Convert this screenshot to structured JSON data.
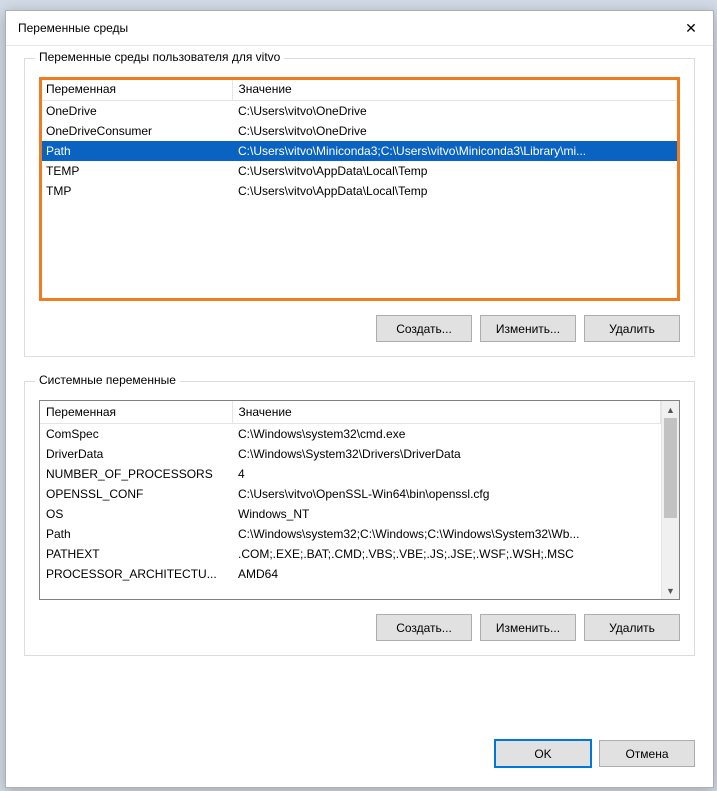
{
  "dialog": {
    "title": "Переменные среды"
  },
  "user_group": {
    "legend": "Переменные среды пользователя для vitvo",
    "col_var": "Переменная",
    "col_val": "Значение",
    "rows": [
      {
        "var": "OneDrive",
        "val": "C:\\Users\\vitvo\\OneDrive",
        "selected": false
      },
      {
        "var": "OneDriveConsumer",
        "val": "C:\\Users\\vitvo\\OneDrive",
        "selected": false
      },
      {
        "var": "Path",
        "val": "C:\\Users\\vitvo\\Miniconda3;C:\\Users\\vitvo\\Miniconda3\\Library\\mi...",
        "selected": true
      },
      {
        "var": "TEMP",
        "val": "C:\\Users\\vitvo\\AppData\\Local\\Temp",
        "selected": false
      },
      {
        "var": "TMP",
        "val": "C:\\Users\\vitvo\\AppData\\Local\\Temp",
        "selected": false
      }
    ],
    "btn_new": "Создать...",
    "btn_edit": "Изменить...",
    "btn_delete": "Удалить"
  },
  "system_group": {
    "legend": "Системные переменные",
    "col_var": "Переменная",
    "col_val": "Значение",
    "rows": [
      {
        "var": "ComSpec",
        "val": "C:\\Windows\\system32\\cmd.exe"
      },
      {
        "var": "DriverData",
        "val": "C:\\Windows\\System32\\Drivers\\DriverData"
      },
      {
        "var": "NUMBER_OF_PROCESSORS",
        "val": "4"
      },
      {
        "var": "OPENSSL_CONF",
        "val": "C:\\Users\\vitvo\\OpenSSL-Win64\\bin\\openssl.cfg"
      },
      {
        "var": "OS",
        "val": "Windows_NT"
      },
      {
        "var": "Path",
        "val": "C:\\Windows\\system32;C:\\Windows;C:\\Windows\\System32\\Wb..."
      },
      {
        "var": "PATHEXT",
        "val": ".COM;.EXE;.BAT;.CMD;.VBS;.VBE;.JS;.JSE;.WSF;.WSH;.MSC"
      },
      {
        "var": "PROCESSOR_ARCHITECTU...",
        "val": "AMD64"
      }
    ],
    "btn_new": "Создать...",
    "btn_edit": "Изменить...",
    "btn_delete": "Удалить"
  },
  "footer": {
    "ok": "OK",
    "cancel": "Отмена"
  }
}
